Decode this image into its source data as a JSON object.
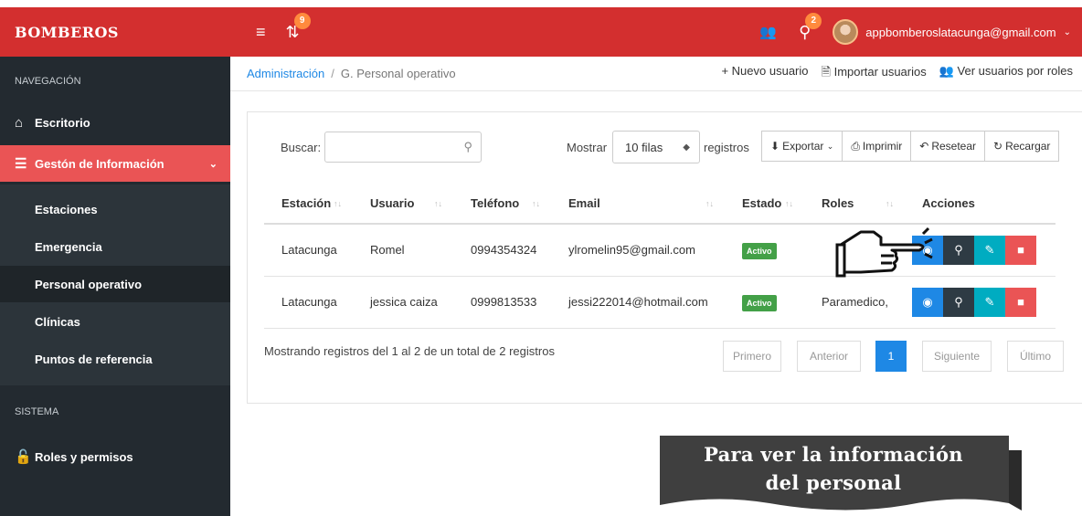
{
  "header": {
    "brand": "BOMBEROS",
    "sync_badge": "9",
    "chat_badge": "2",
    "user_email": "appbomberoslatacunga@gmail.com"
  },
  "sidebar": {
    "nav_title": "NAVEGACIÓN",
    "items": [
      {
        "label": "Escritorio"
      },
      {
        "label": "Gestón de Información"
      }
    ],
    "submenu": [
      {
        "label": "Estaciones"
      },
      {
        "label": "Emergencia"
      },
      {
        "label": "Personal operativo"
      },
      {
        "label": "Clínicas"
      },
      {
        "label": "Puntos de referencia"
      }
    ],
    "system_title": "SISTEMA",
    "roles_label": "Roles y permisos"
  },
  "breadcrumb": {
    "root": "Administración",
    "separator": "/",
    "current": "G. Personal operativo"
  },
  "toolbar": {
    "new_user": "Nuevo usuario",
    "import_users": "Importar usuarios",
    "view_by_roles": "Ver usuarios por roles"
  },
  "table_controls": {
    "search_label": "Buscar:",
    "show_label": "Mostrar",
    "rows_select": "10 filas",
    "records_label": "registros",
    "export": "Exportar",
    "print": "Imprimir",
    "reset": "Resetear",
    "reload": "Recargar"
  },
  "table": {
    "headers": [
      "Estación",
      "Usuario",
      "Teléfono",
      "Email",
      "Estado",
      "Roles",
      "Acciones"
    ],
    "rows": [
      {
        "station": "Latacunga",
        "user": "Romel",
        "phone": "0994354324",
        "email": "ylromelin95@gmail.com",
        "status": "Activo",
        "roles": ""
      },
      {
        "station": "Latacunga",
        "user": "jessica caiza",
        "phone": "0999813533",
        "email": "jessi222014@hotmail.com",
        "status": "Activo",
        "roles": "Paramedico,"
      }
    ]
  },
  "footer": {
    "info": "Mostrando registros del 1 al 2 de un total de 2 registros",
    "first": "Primero",
    "prev": "Anterior",
    "page": "1",
    "next": "Siguiente",
    "last": "Último"
  },
  "banner": {
    "line1": "Para ver la información",
    "line2": "del personal"
  },
  "colors": {
    "brand_red": "#d32f2f",
    "active_menu": "#ea5455",
    "sidebar_bg": "#232a30",
    "primary_blue": "#1e88e5",
    "status_green": "#43a047"
  }
}
